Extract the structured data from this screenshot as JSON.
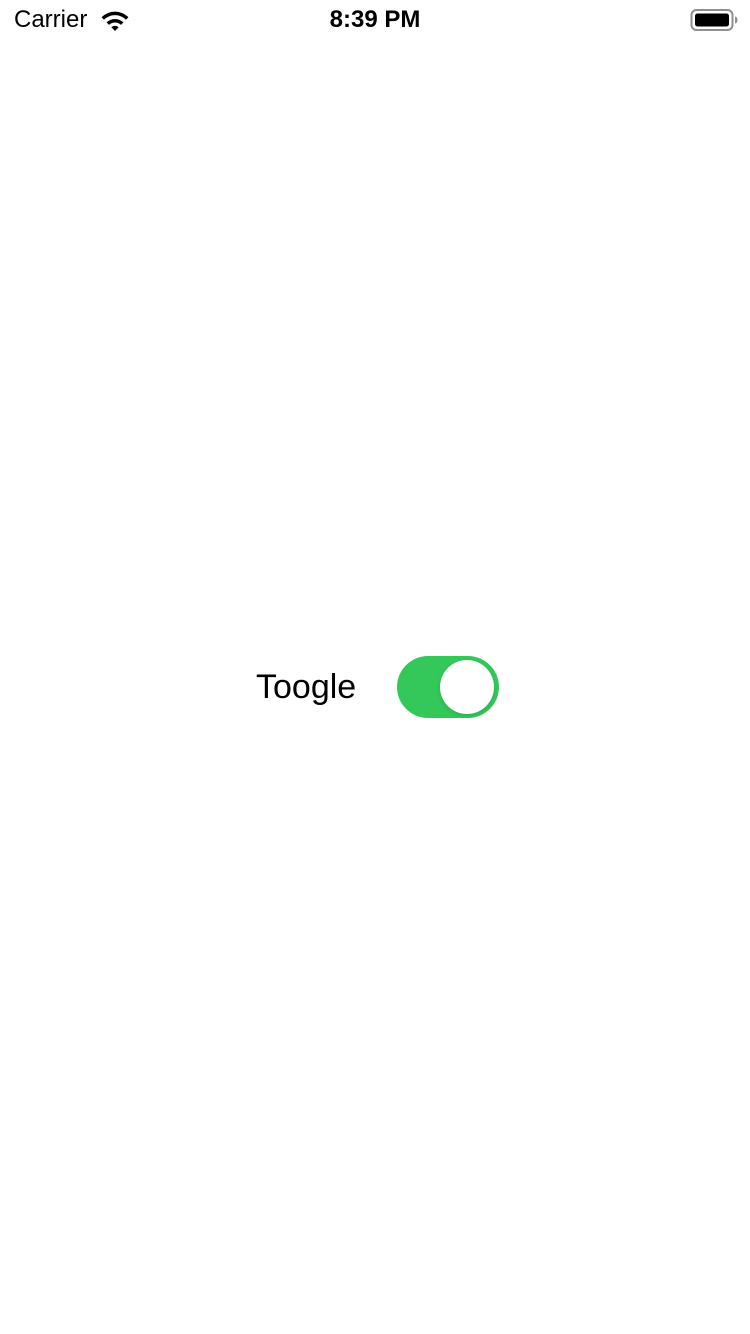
{
  "status_bar": {
    "carrier": "Carrier",
    "time": "8:39 PM",
    "wifi_icon": "wifi-icon",
    "battery_icon": "battery-icon"
  },
  "toggle": {
    "label": "Toogle",
    "state": "on",
    "on_color": "#34c759",
    "knob_color": "#ffffff"
  },
  "colors": {
    "background": "#ffffff",
    "text": "#000000",
    "accent": "#34c759"
  }
}
